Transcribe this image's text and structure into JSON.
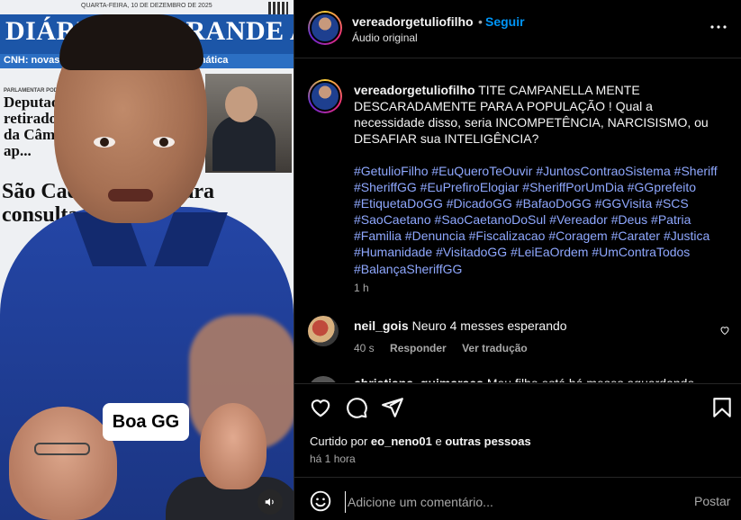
{
  "media": {
    "newspaper_title": "DIÁRIO DO GRANDE ABC",
    "newspaper_date": "QUARTA-FEIRA, 10 DE DEZEMBRO DE 2025",
    "newspaper_bar": "CNH: novas regras ... em renovação automática",
    "newspaper_section": "PARLAMENTAR PODE VER",
    "newspaper_headline1": "Deputado Gl... retirado à for... da Câmara, ap...",
    "newspaper_headline2": "São Caet... espera para consultas ... specialistas",
    "caption_overlay": "Boa GG",
    "volume_icon": "speaker-icon"
  },
  "header": {
    "username": "vereadorgetuliofilho",
    "separator": "•",
    "follow_label": "Seguir",
    "audio_label": "Áudio original",
    "more_icon": "more-horizontal-icon"
  },
  "caption": {
    "username": "vereadorgetuliofilho",
    "text": "TITE CAMPANELLA MENTE DESCARADAMENTE PARA A POPULAÇÃO ! Qual a necessidade disso, seria INCOMPETÊNCIA, NARCISISMO, ou DESAFIAR sua INTELIGÊNCIA?",
    "hashtags": [
      "#GetulioFilho",
      "#EuQueroTeOuvir",
      "#JuntosContraoSistema",
      "#Sheriff",
      "#SheriffGG",
      "#EuPrefiroElogiar",
      "#SheriffPorUmDia",
      "#GGprefeito",
      "#EtiquetaDoGG",
      "#DicadoGG",
      "#BafaoDoGG",
      "#GGVisita",
      "#SCS",
      "#SaoCaetano",
      "#SaoCaetanoDoSul",
      "#Vereador",
      "#Deus",
      "#Patria",
      "#Familia",
      "#Denuncia",
      "#Fiscalizacao",
      "#Coragem",
      "#Carater",
      "#Justica",
      "#Humanidade",
      "#VisitadoGG",
      "#LeiEaOrdem",
      "#UmContraTodos",
      "#BalançaSheriffGG"
    ],
    "time": "1 h"
  },
  "comments": [
    {
      "username": "neil_gois",
      "text": "Neuro 4 messes esperando",
      "time": "40 s",
      "reply_label": "Responder",
      "translate_label": "Ver tradução"
    },
    {
      "username": "christiana_guimaraes",
      "text": "Meu filho está há meses aguardando"
    }
  ],
  "actions": {
    "like_icon": "heart-icon",
    "comment_icon": "comment-icon",
    "share_icon": "send-icon",
    "save_icon": "bookmark-icon",
    "liked_prefix": "Curtido por ",
    "liked_user": "eo_neno01",
    "liked_middle": " e ",
    "liked_others": "outras pessoas",
    "post_time": "há 1 hora"
  },
  "comment_box": {
    "placeholder": "Adicione um comentário...",
    "post_label": "Postar",
    "emoji_icon": "emoji-icon"
  },
  "colors": {
    "background": "#000000",
    "link_blue": "#0095f6",
    "hashtag": "#8fa8ff",
    "muted": "#a8a8a8"
  }
}
